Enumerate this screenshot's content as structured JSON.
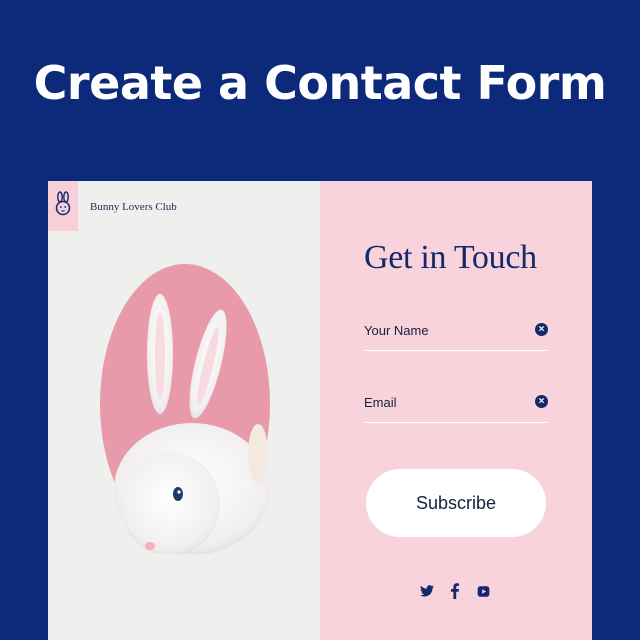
{
  "headline": "Create a Contact Form",
  "brand": {
    "name": "Bunny Lovers Club",
    "logo_icon": "bunny-icon"
  },
  "form": {
    "title": "Get in Touch",
    "fields": [
      {
        "label": "Your Name",
        "action_icon": "clear-icon"
      },
      {
        "label": "Email",
        "action_icon": "clear-icon"
      }
    ],
    "submit_label": "Subscribe"
  },
  "socials": [
    "twitter-icon",
    "facebook-icon",
    "youtube-icon"
  ],
  "colors": {
    "background": "#0d2a7a",
    "left_panel": "#efefee",
    "right_panel": "#f8d3dc",
    "accent_dark": "#14286a",
    "photo_circle": "#e89aaa"
  }
}
